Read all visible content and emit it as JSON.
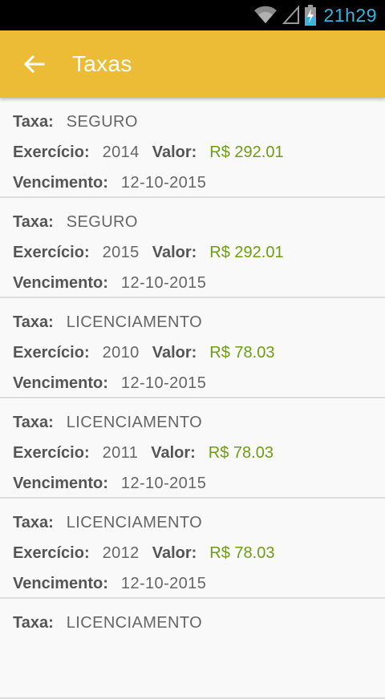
{
  "status_bar": {
    "time": "21h29",
    "icons": [
      "wifi-icon",
      "signal-icon",
      "battery-charging-icon"
    ]
  },
  "app_bar": {
    "title": "Taxas",
    "back_icon": "arrow-left-icon",
    "color": "#ecbc37"
  },
  "labels": {
    "taxa": "Taxa:",
    "exercicio": "Exercício:",
    "valor": "Valor:",
    "vencimento": "Vencimento:"
  },
  "items": [
    {
      "taxa": "SEGURO",
      "exercicio": "2014",
      "valor": "R$ 292.01",
      "vencimento": "12-10-2015"
    },
    {
      "taxa": "SEGURO",
      "exercicio": "2015",
      "valor": "R$ 292.01",
      "vencimento": "12-10-2015"
    },
    {
      "taxa": "LICENCIAMENTO",
      "exercicio": "2010",
      "valor": "R$ 78.03",
      "vencimento": "12-10-2015"
    },
    {
      "taxa": "LICENCIAMENTO",
      "exercicio": "2011",
      "valor": "R$ 78.03",
      "vencimento": "12-10-2015"
    },
    {
      "taxa": "LICENCIAMENTO",
      "exercicio": "2012",
      "valor": "R$ 78.03",
      "vencimento": "12-10-2015"
    },
    {
      "taxa": "LICENCIAMENTO"
    }
  ],
  "colors": {
    "money": "#6d9e0f",
    "status_time": "#33b5e5"
  }
}
